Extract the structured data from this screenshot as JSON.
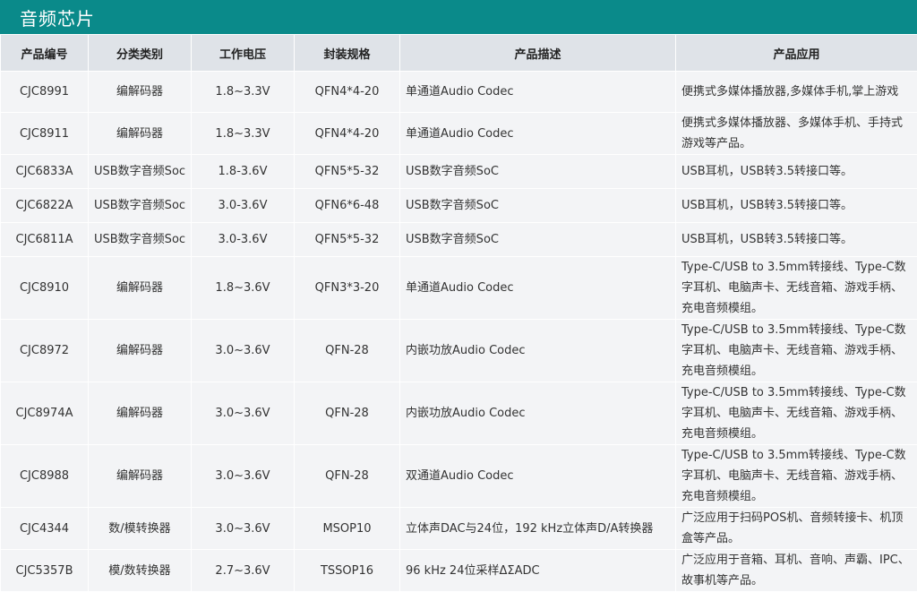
{
  "section_title": "音频芯片",
  "headers": [
    "产品编号",
    "分类类别",
    "工作电压",
    "封装规格",
    "产品描述",
    "产品应用"
  ],
  "rows": [
    [
      "CJC8991",
      "编解码器",
      "1.8~3.3V",
      "QFN4*4-20",
      "单通道Audio Codec",
      "便携式多媒体播放器,多媒体手机,掌上游戏"
    ],
    [
      "CJC8911",
      "编解码器",
      "1.8~3.3V",
      "QFN4*4-20",
      "单通道Audio Codec",
      "便携式多媒体播放器、多媒体手机、手持式游戏等产品。"
    ],
    [
      "CJC6833A",
      "USB数字音频Soc",
      "1.8-3.6V",
      "QFN5*5-32",
      "USB数字音频SoC",
      "USB耳机，USB转3.5转接口等。"
    ],
    [
      "CJC6822A",
      "USB数字音频Soc",
      "3.0-3.6V",
      "QFN6*6-48",
      "USB数字音频SoC",
      "USB耳机，USB转3.5转接口等。"
    ],
    [
      "CJC6811A",
      "USB数字音频Soc",
      "3.0-3.6V",
      "QFN5*5-32",
      "USB数字音频SoC",
      "USB耳机，USB转3.5转接口等。"
    ],
    [
      "CJC8910",
      "编解码器",
      "1.8~3.6V",
      "QFN3*3-20",
      "单通道Audio Codec",
      "Type-C/USB to 3.5mm转接线、Type-C数字耳机、电脑声卡、无线音箱、游戏手柄、充电音频模组。"
    ],
    [
      "CJC8972",
      "编解码器",
      "3.0~3.6V",
      "QFN-28",
      "内嵌功放Audio Codec",
      "Type-C/USB to 3.5mm转接线、Type-C数字耳机、电脑声卡、无线音箱、游戏手柄、充电音频模组。"
    ],
    [
      "CJC8974A",
      "编解码器",
      "3.0~3.6V",
      "QFN-28",
      "内嵌功放Audio Codec",
      "Type-C/USB to 3.5mm转接线、Type-C数字耳机、电脑声卡、无线音箱、游戏手柄、充电音频模组。"
    ],
    [
      "CJC8988",
      "编解码器",
      "3.0~3.6V",
      "QFN-28",
      "双通道Audio Codec",
      "Type-C/USB to 3.5mm转接线、Type-C数字耳机、电脑声卡、无线音箱、游戏手柄、充电音频模组。"
    ],
    [
      "CJC4344",
      "数/模转换器",
      "3.0~3.6V",
      "MSOP10",
      "立体声DAC与24位，192 kHz立体声D/A转换器",
      "广泛应用于扫码POS机、音频转接卡、机顶盒等产品。"
    ],
    [
      "CJC5357B",
      "模/数转换器",
      "2.7~3.6V",
      "TSSOP16",
      "96 kHz 24位采样ΔΣADC",
      "广泛应用于音箱、耳机、音响、声霸、IPC、故事机等产品。"
    ]
  ],
  "colors": {
    "title_bg": "#0a8a8a",
    "header_bg": "#dfe3e8",
    "row_bg": "#f3f4f6"
  }
}
